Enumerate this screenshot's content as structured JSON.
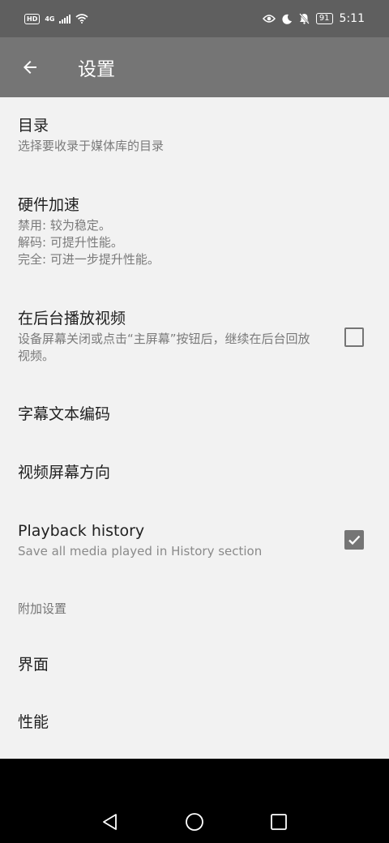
{
  "status_bar": {
    "hd": "HD",
    "network": "4G",
    "battery": "91",
    "time": "5:11"
  },
  "app_bar": {
    "title": "设置"
  },
  "preferences": {
    "directories": {
      "title": "目录",
      "summary": "选择要收录于媒体库的目录"
    },
    "hw_accel": {
      "title": "硬件加速",
      "summary": "禁用: 较为稳定。\n解码: 可提升性能。\n完全: 可进一步提升性能。"
    },
    "background_play": {
      "title": "在后台播放视频",
      "summary": "设备屏幕关闭或点击“主屏幕”按钮后，继续在后台回放视频。",
      "checked": false
    },
    "subtitle_encoding": {
      "title": "字幕文本编码"
    },
    "video_orientation": {
      "title": "视频屏幕方向"
    },
    "playback_history": {
      "title": "Playback history",
      "summary": "Save all media played in History section",
      "checked": true
    },
    "extra_category": "附加设置",
    "interface": {
      "title": "界面"
    },
    "performance": {
      "title": "性能"
    }
  },
  "colors": {
    "status_bar": "#5f5f5f",
    "app_bar": "#757575",
    "background": "#f2f2f2",
    "checkbox": "#757575"
  }
}
